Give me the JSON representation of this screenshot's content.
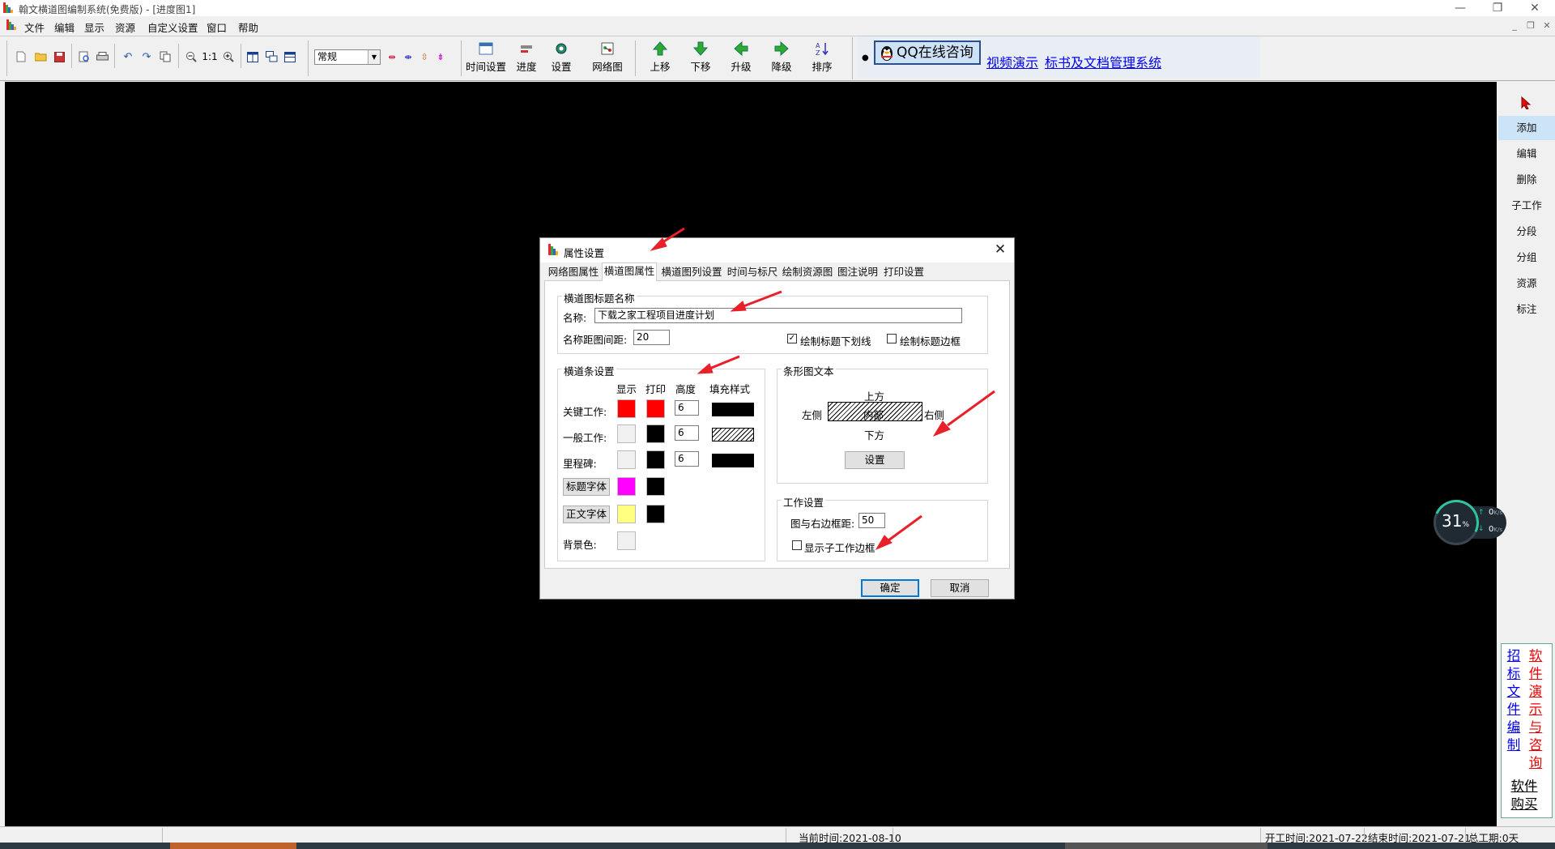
{
  "window": {
    "title": "翰文横道图编制系统(免费版) - [进度图1]"
  },
  "menu": [
    "文件",
    "编辑",
    "显示",
    "资源",
    "自定义设置",
    "窗口",
    "帮助"
  ],
  "toolbar": {
    "zoom_value": "常规",
    "big_buttons": [
      "时间设置",
      "进度",
      "设置",
      "网络图",
      "上移",
      "下移",
      "升级",
      "降级",
      "排序"
    ]
  },
  "web": {
    "qq_label": "QQ在线咨询",
    "link1": "视频演示",
    "link2": "标书及文档管理系统"
  },
  "right_panel": {
    "items": [
      "添加",
      "编辑",
      "删除",
      "子工作",
      "分段",
      "分组",
      "资源",
      "标注"
    ],
    "vlink1": [
      "招",
      "标",
      "文",
      "件",
      "编",
      "制"
    ],
    "vlink2": [
      "软",
      "件",
      "演",
      "示",
      "与",
      "咨",
      "询"
    ],
    "buy": [
      "软件",
      "购买"
    ]
  },
  "status": {
    "current_time": "当前时间:2021-08-10",
    "start_time": "开工时间:2021-07-22",
    "end_time": "结束时间:2021-07-21",
    "total": "总工期:0天"
  },
  "net_widget": {
    "percent": "31",
    "percent_unit": "%",
    "up": "0",
    "down": "0",
    "unit": "K/s"
  },
  "dialog": {
    "title": "属性设置",
    "tabs": [
      "网络图属性",
      "横道图属性",
      "横道图列设置",
      "时间与标尺",
      "绘制资源图",
      "图注说明",
      "打印设置"
    ],
    "active_tab": 1,
    "title_group": {
      "legend": "横道图标题名称",
      "name_label": "名称:",
      "name_value": "下载之家工程项目进度计划",
      "gap_label": "名称距图间距:",
      "gap_value": "20",
      "underline_label": "绘制标题下划线",
      "underline_checked": true,
      "border_label": "绘制标题边框",
      "border_checked": false
    },
    "bar_group": {
      "legend": "横道条设置",
      "headers": [
        "显示",
        "打印",
        "高度",
        "填充样式"
      ],
      "rows": [
        {
          "label": "关键工作:",
          "show_color": "#ff0000",
          "print_color": "#ff0000",
          "height": "6",
          "fill": "solid"
        },
        {
          "label": "一般工作:",
          "show_color": "#f0f0f0",
          "print_color": "#000000",
          "height": "6",
          "fill": "hatch"
        },
        {
          "label": "里程碑:",
          "show_color": "#f0f0f0",
          "print_color": "#000000",
          "height": "6",
          "fill": "solid"
        }
      ],
      "title_font_btn": "标题字体",
      "title_font_show": "#ff00ff",
      "title_font_print": "#000000",
      "body_font_btn": "正文字体",
      "body_font_show": "#ffff80",
      "body_font_print": "#000000",
      "bg_label": "背景色:",
      "bg_color": "#f0f0f0"
    },
    "text_group": {
      "legend": "条形图文本",
      "top": "上方",
      "left": "左侧",
      "inside": "内部",
      "right": "右侧",
      "bottom": "下方",
      "set_btn": "设置"
    },
    "work_group": {
      "legend": "工作设置",
      "margin_label": "图与右边框距:",
      "margin_value": "50",
      "sub_border_label": "显示子工作边框",
      "sub_border_checked": false
    },
    "ok": "确定",
    "cancel": "取消"
  }
}
